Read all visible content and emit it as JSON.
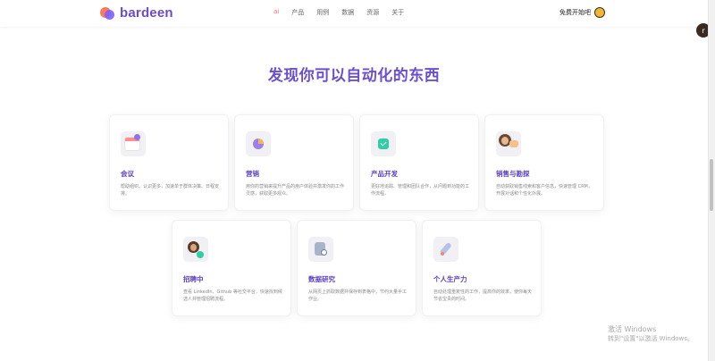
{
  "brand": {
    "name": "bardeen"
  },
  "nav": [
    "ai",
    "产品",
    "用例",
    "数据",
    "资源",
    "关于"
  ],
  "signin": {
    "label": "免费开始吧"
  },
  "side_button": {
    "label": "r"
  },
  "main": {
    "title": "发现你可以自动化的东西",
    "cards": [
      {
        "title": "会议",
        "desc": "帮助组织、认识更多，加速单于群体决策、日程安排。",
        "icon": "calendar-icon"
      },
      {
        "title": "营销",
        "desc": "用你的营销来提升产品的用户体验并激发你的工作灵感，获取更多观众。",
        "icon": "chart-icon"
      },
      {
        "title": "产品开发",
        "desc": "更好地追踪、管理和团队合作，从问题到功能的工作流程。",
        "icon": "check-icon"
      },
      {
        "title": "销售与勘探",
        "desc": "自动获取销售线索和客户信息，快速管理 CRM，开展对话和个性化外展。",
        "icon": "person-icon"
      },
      {
        "title": "招聘中",
        "desc": "查看 LinkedIn、Github 等社交平台，快速找到候选人并管理招聘流程。",
        "icon": "recruit-icon"
      },
      {
        "title": "数据研究",
        "desc": "从网页上抓取数据并保存到表格中，节约大量手工作业。",
        "icon": "search-icon"
      },
      {
        "title": "个人生产力",
        "desc": "自动处理重复性的工作，提高你的效率，使你每天节省宝贵的时间。",
        "icon": "rocket-icon"
      }
    ]
  },
  "watermark": {
    "line1": "激活 Windows",
    "line2": "转到\"设置\"以激活 Windows。"
  },
  "colors": {
    "brand_purple": "#6b4fce",
    "accent_red": "#f46a6a"
  }
}
